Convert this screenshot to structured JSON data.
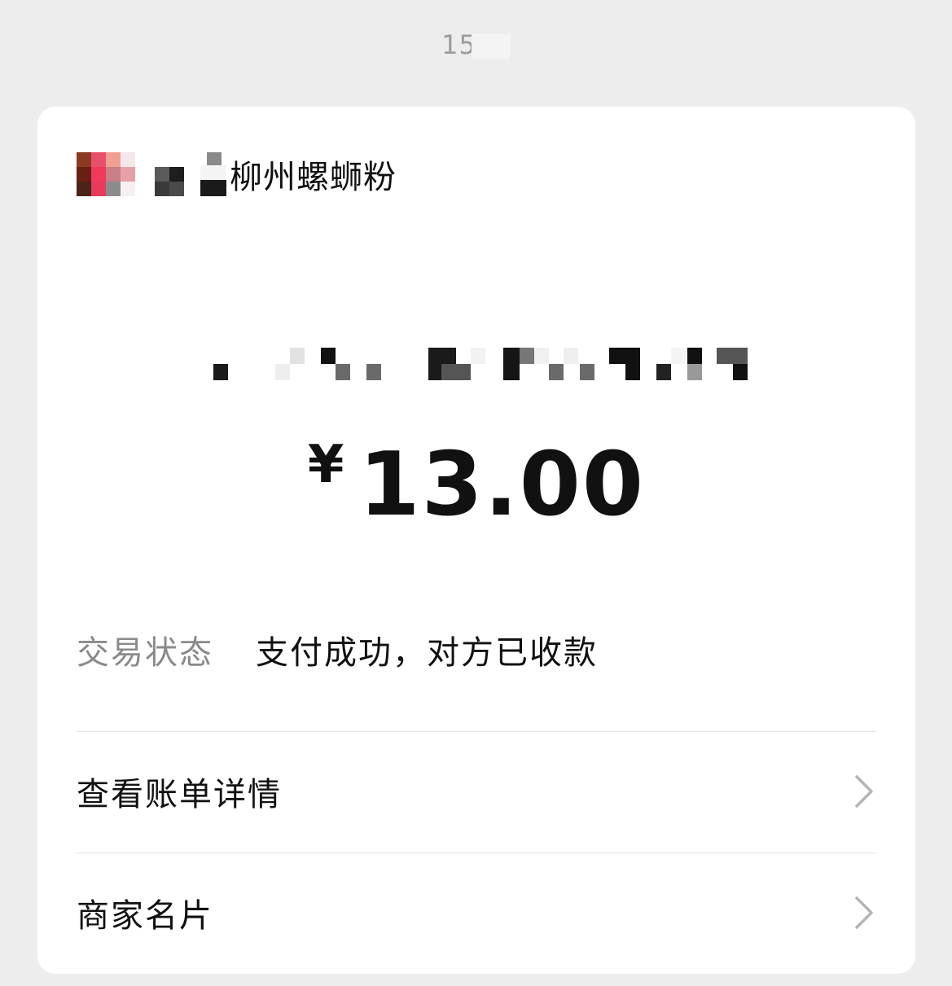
{
  "header": {
    "time": "15"
  },
  "merchant": {
    "name": "柳州螺蛳粉"
  },
  "payment": {
    "currency": "¥",
    "amount": "13.00"
  },
  "status": {
    "label": "交易状态",
    "value": "支付成功，对方已收款"
  },
  "rows": [
    {
      "label": "查看账单详情",
      "icon": "chevron-right-icon"
    },
    {
      "label": "商家名片",
      "icon": "chevron-right-icon"
    }
  ],
  "colors": {
    "background": "#ededed",
    "card": "#ffffff",
    "text": "#111111",
    "muted": "#8a8a8a"
  }
}
